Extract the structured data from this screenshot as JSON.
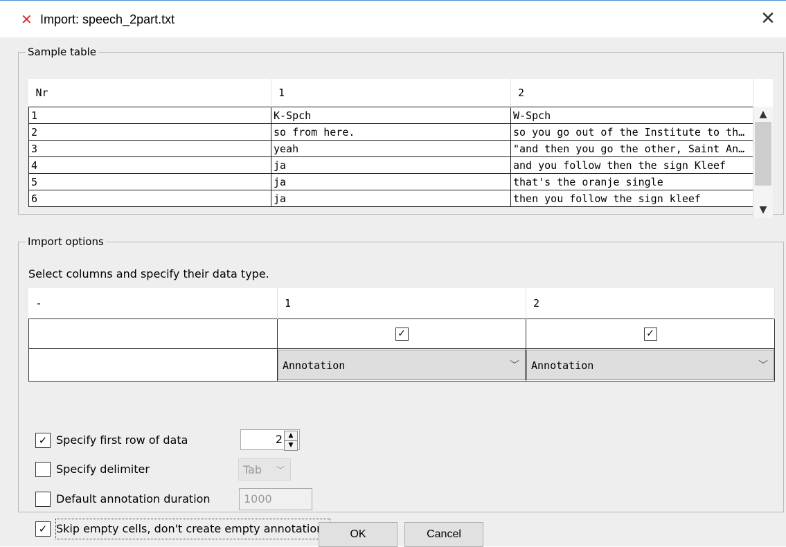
{
  "window": {
    "title": "Import: speech_2part.txt",
    "app_icon": "elan-logo-icon",
    "close_icon": "close-x-icon"
  },
  "sample_table": {
    "legend": "Sample table",
    "headers": [
      "Nr",
      "1",
      "2"
    ],
    "rows": [
      [
        "1",
        "K-Spch",
        "W-Spch"
      ],
      [
        "2",
        "so from here.",
        "so you go out of the Institute to the S..."
      ],
      [
        "3",
        "yeah",
        "\"and then you go the other, Saint Ann..."
      ],
      [
        "4",
        "ja",
        "and you follow then the sign Kleef"
      ],
      [
        "5",
        "ja",
        "that's the oranje single"
      ],
      [
        "6",
        "ja",
        "then you follow the sign kleef"
      ]
    ],
    "scroll_up": "^",
    "scroll_down": "v"
  },
  "import_options": {
    "legend": "Import options",
    "instruction": "Select columns and specify their data type.",
    "column_headers": [
      "-",
      "1",
      "2"
    ],
    "column_checkboxes": [
      "",
      "checked",
      "checked"
    ],
    "column_types": [
      "",
      "Annotation",
      "Annotation"
    ],
    "first_row": {
      "label": "Specify first row of data",
      "checked": true,
      "value": "2"
    },
    "delimiter": {
      "label": "Specify delimiter",
      "checked": false,
      "value": "Tab"
    },
    "duration": {
      "label": "Default annotation duration",
      "checked": false,
      "value": "1000"
    },
    "skip_empty": {
      "label": "Skip empty cells, don't create empty annotations",
      "checked": true
    }
  },
  "buttons": {
    "ok": "OK",
    "cancel": "Cancel"
  }
}
